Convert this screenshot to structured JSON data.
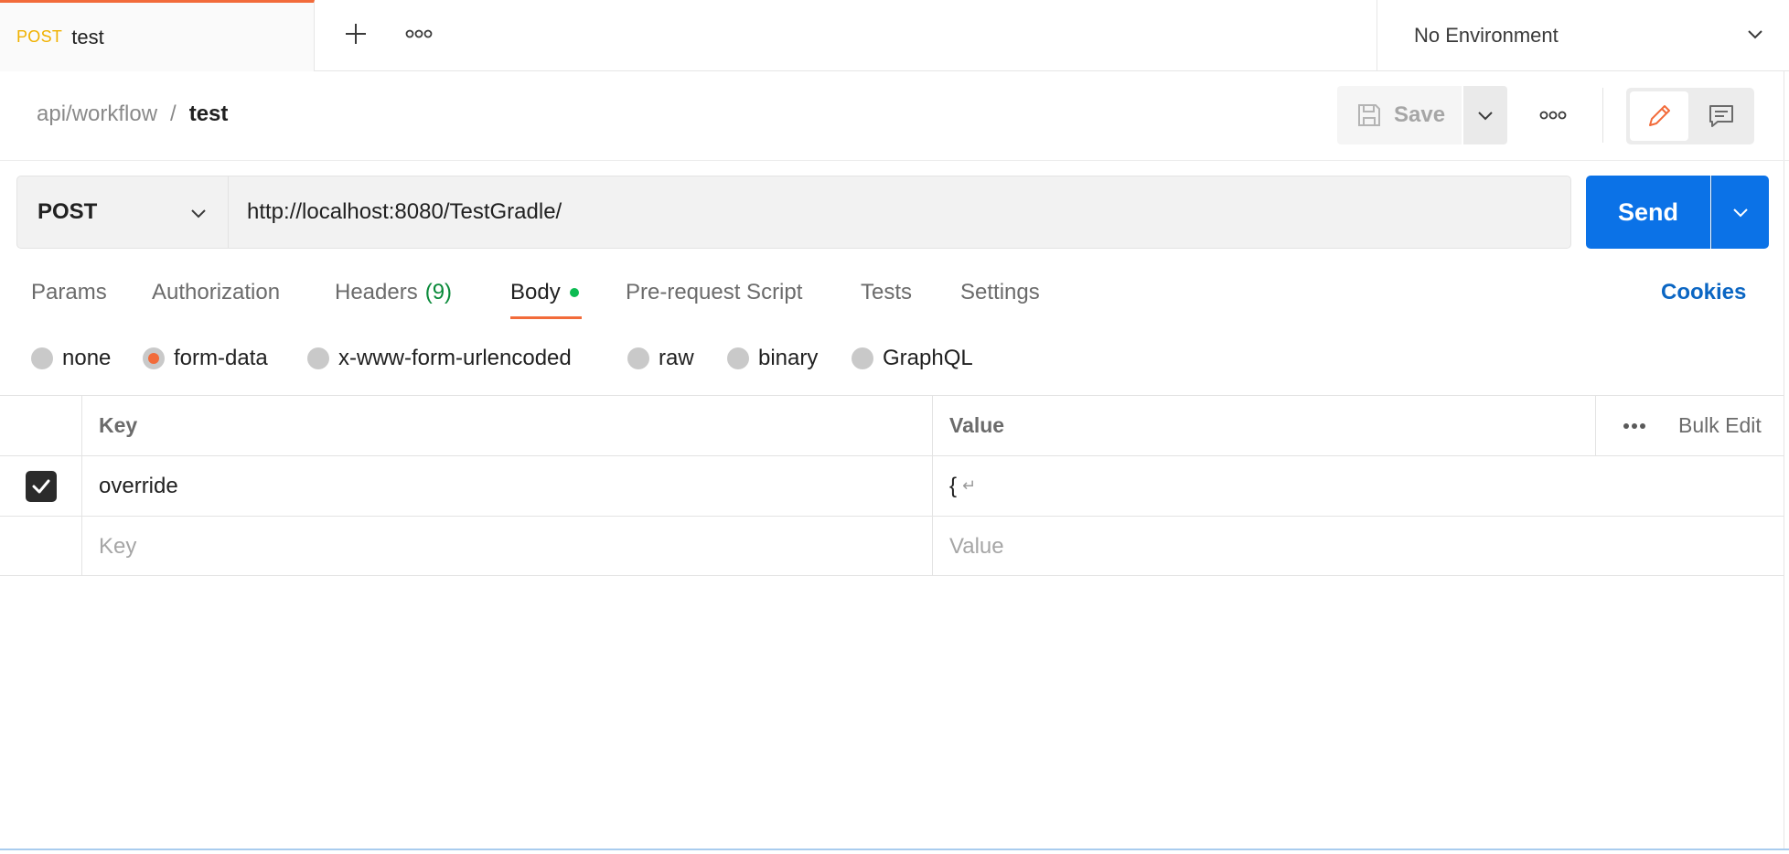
{
  "tabbar": {
    "tab": {
      "method": "POST",
      "name": "test"
    },
    "environment": "No Environment"
  },
  "header": {
    "breadcrumb_parent": "api/workflow",
    "breadcrumb_separator": "/",
    "breadcrumb_current": "test",
    "save_label": "Save"
  },
  "request": {
    "method": "POST",
    "url": "http://localhost:8080/TestGradle/",
    "send_label": "Send"
  },
  "request_tabs": {
    "params": "Params",
    "authorization": "Authorization",
    "headers": "Headers",
    "headers_count": "(9)",
    "body": "Body",
    "pre_request": "Pre-request Script",
    "tests": "Tests",
    "settings": "Settings",
    "cookies": "Cookies",
    "active": "Body"
  },
  "body_types": {
    "none": "none",
    "form_data": "form-data",
    "urlencoded": "x-www-form-urlencoded",
    "raw": "raw",
    "binary": "binary",
    "graphql": "GraphQL",
    "selected": "form-data"
  },
  "table": {
    "key_header": "Key",
    "value_header": "Value",
    "bulk_edit": "Bulk Edit",
    "rows": [
      {
        "checked": true,
        "key": "override",
        "value": "{"
      }
    ],
    "key_placeholder": "Key",
    "value_placeholder": "Value"
  },
  "colors": {
    "accent": "#f26b3a",
    "send": "#0b72e7",
    "method_tab": "#f0b100",
    "link": "#0b66c3",
    "dot": "#0cbb52"
  },
  "icons": [
    "plus-icon",
    "more-icon",
    "chevron-down-icon",
    "save-icon",
    "pencil-icon",
    "comment-icon",
    "checkmark-icon",
    "return-icon"
  ]
}
